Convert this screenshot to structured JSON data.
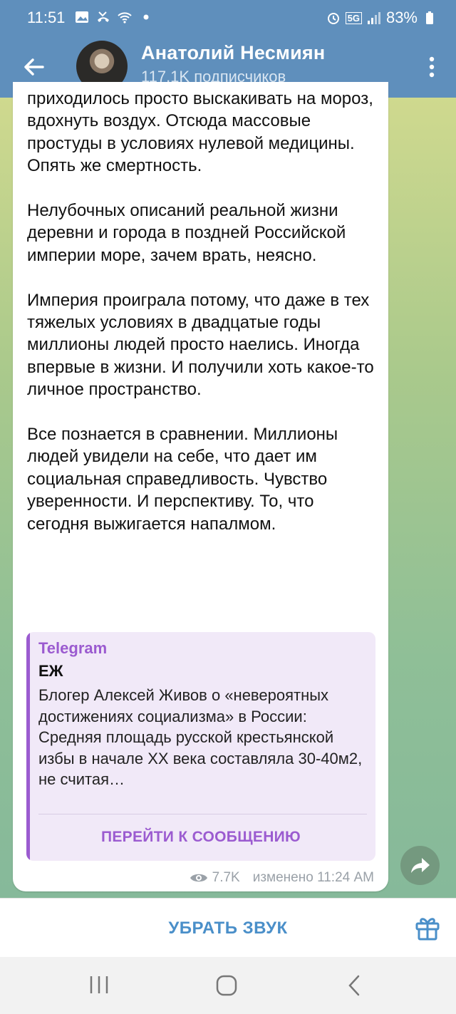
{
  "status_bar": {
    "time": "11:51",
    "network": "5G",
    "battery": "83%"
  },
  "header": {
    "title": "Анатолий Несмиян",
    "subtitle": "117.1K подписчиков"
  },
  "message": {
    "paragraphs": [
      "приходилось просто выскакивать на мороз, вдохнуть воздух. Отсюда массовые простуды в условиях нулевой медицины. Опять же смертность.",
      "Нелубочных описаний реальной жизни деревни и города в поздней Российской империи море, зачем врать, неясно.",
      "Империя проиграла потому, что даже в тех тяжелых условиях в двадцатые годы миллионы людей просто наелись. Иногда впервые в жизни. И получили хоть какое-то личное пространство.",
      "Все познается в сравнении. Миллионы людей увидели на себе, что дает им социальная справедливость. Чувство уверенности. И перспективу. То, что сегодня выжигается напалмом."
    ],
    "quote": {
      "source": "Telegram",
      "author": "ЕЖ",
      "text": "Блогер Алексей Живов о «невероятных достижениях социализма» в России:\nСредняя площадь русской крестьянской избы в начале XX века составляла 30-40м2, не считая…",
      "button": "ПЕРЕЙТИ К СООБЩЕНИЮ"
    },
    "views": "7.7K",
    "edited": "изменено 11:24 AM"
  },
  "bottom_bar": {
    "mute_label": "УБРАТЬ ЗВУК"
  },
  "colors": {
    "header_bg": "#5f8fbc",
    "accent_purple": "#9b5bd0",
    "mute_blue": "#4a8fc9"
  }
}
